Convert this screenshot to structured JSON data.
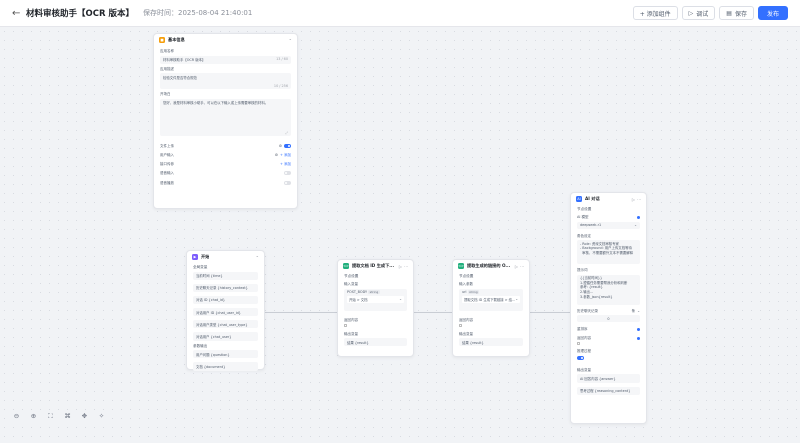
{
  "header": {
    "back_icon": "←",
    "title": "材料审核助手【OCR 版本】",
    "save_time": "保存时间：2025-08-04 21:40:01",
    "add_component": "+ 添加组件",
    "debug": "调试",
    "save": "保存",
    "publish": "发布",
    "accent": "#3370ff"
  },
  "basic_info": {
    "title": "基本信息",
    "app_name_label": "应用名称",
    "app_name": "材料审核助手【OCR 版本】",
    "app_name_count": "13 / 60",
    "desc_label": "应用描述",
    "desc": "检验文件是否符合规范",
    "desc_count": "10 / 256",
    "opening_label": "开场白",
    "opening": "您好，我是材料审核小助手，可以在以下输入或上传需要审核的材料。",
    "file_upload": "文件上传",
    "user_input": "用户输入",
    "add": "添加",
    "interface_params": "接口传参",
    "voice_input": "语音输入",
    "voice_output": "语音播放"
  },
  "start_node": {
    "title": "开始",
    "global_vars": "全局变量",
    "items": [
      "当前时间 {time}",
      "历史聊天记录 {history_context}",
      "对话 ID {chat_id}",
      "对话用户 ID {chat_user_id}",
      "对话用户类型 {chat_user_type}",
      "对话用户 {chat_user}"
    ],
    "params_label": "参数输出",
    "params": [
      "用户问题 {question}",
      "文档 {document}"
    ]
  },
  "doc_node": {
    "title": "提取文档 ID 生成下...",
    "node_setting": "节点设置",
    "input_vars": "输入变量",
    "var_name": "POST_BODY",
    "var_type": "string",
    "var_select": "开始 > 文档",
    "return_label": "返回内容",
    "output_label": "输出变量",
    "output": "结果 {result}"
  },
  "url_node": {
    "title": "提取生成的链接的 O...",
    "node_setting": "节点设置",
    "input_vars": "输入参数",
    "var_name": "url",
    "var_type": "string",
    "var_select": "提取文档 ID 生成下载链接 > 结...",
    "return_label": "返回内容",
    "output_label": "输出变量",
    "output": "结果 {result}"
  },
  "ai_node": {
    "title": "AI 对话",
    "node_setting": "节点设置",
    "model_label": "AI 模型",
    "model": "deepseek-r1",
    "role_label": "角色设定",
    "role": "- Role: 资深文档审核专家\n- Background: 用户上传文档等待\n  审核，不需要额外文本不需要解释",
    "prompt_label": "提示词",
    "prompt": "{{当前时间}}\n1.遵循任务需要帮我分析和判断\n参考: {result}\n2.输出...\n3.参数_json{result}",
    "history_label": "历史聊天记录",
    "history_value": "0",
    "history_unit": "条",
    "rerank_label": "重排序",
    "return_label": "返回内容",
    "reasoning_label": "推理过程",
    "output_label": "输出变量",
    "outputs": [
      "AI 回答内容 {answer}",
      "思考过程 {reasoning_content}"
    ]
  },
  "tools": {
    "zoom_out": "zoom-out",
    "zoom_in": "zoom-in",
    "fit": "fit",
    "layout": "layout",
    "move": "move",
    "beautify": "beautify"
  }
}
